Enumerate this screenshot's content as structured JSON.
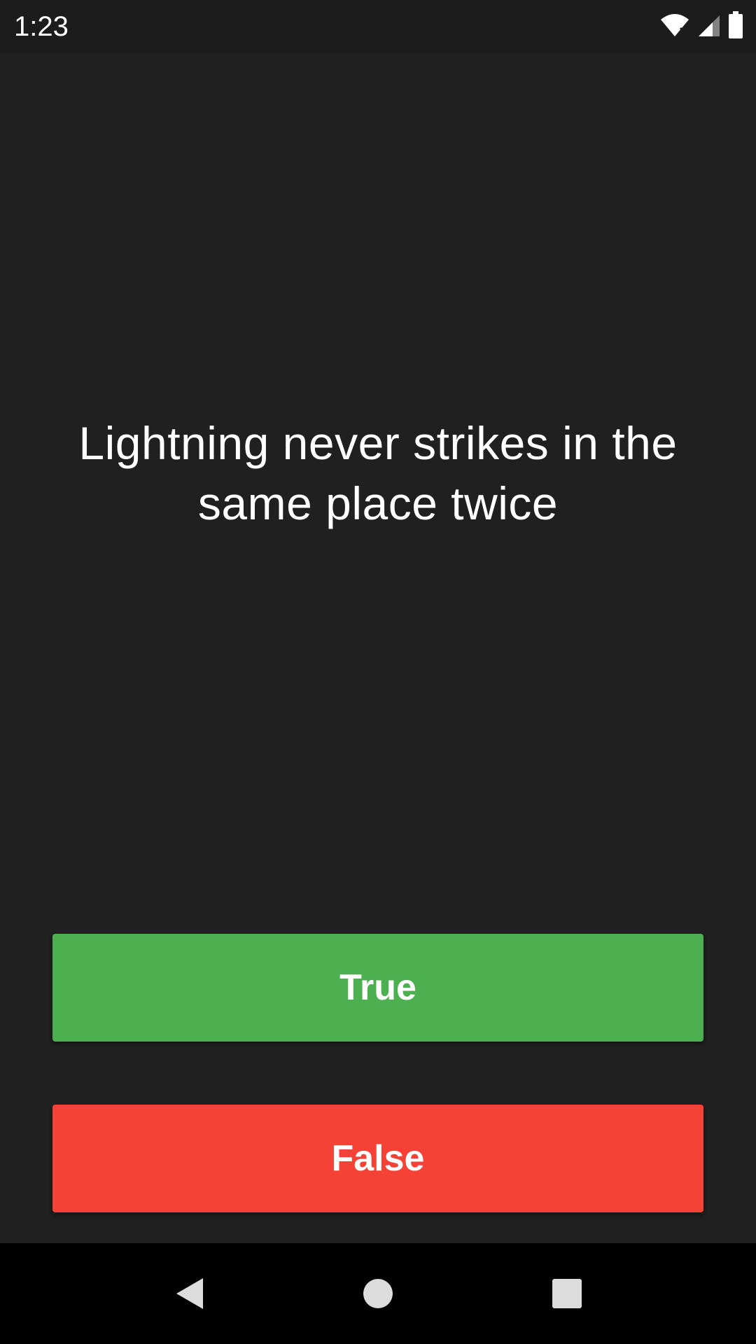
{
  "status_bar": {
    "time": "1:23",
    "icons": [
      "wifi-icon",
      "signal-icon",
      "battery-icon"
    ]
  },
  "quiz": {
    "question": "Lightning never strikes in the same place twice",
    "true_label": "True",
    "false_label": "False"
  },
  "nav_bar": {
    "icons": [
      "back-icon",
      "home-icon",
      "recents-icon"
    ]
  },
  "colors": {
    "background": "#202020",
    "true_button": "#4caf50",
    "false_button": "#f44336",
    "text": "#ffffff"
  }
}
